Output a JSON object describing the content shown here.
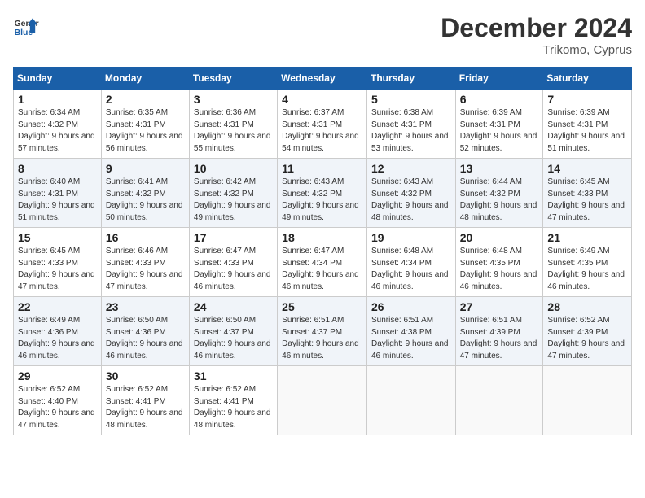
{
  "header": {
    "logo_line1": "General",
    "logo_line2": "Blue",
    "month_year": "December 2024",
    "location": "Trikomo, Cyprus"
  },
  "days_of_week": [
    "Sunday",
    "Monday",
    "Tuesday",
    "Wednesday",
    "Thursday",
    "Friday",
    "Saturday"
  ],
  "weeks": [
    [
      {
        "day": "1",
        "sunrise": "6:34 AM",
        "sunset": "4:32 PM",
        "daylight": "9 hours and 57 minutes."
      },
      {
        "day": "2",
        "sunrise": "6:35 AM",
        "sunset": "4:31 PM",
        "daylight": "9 hours and 56 minutes."
      },
      {
        "day": "3",
        "sunrise": "6:36 AM",
        "sunset": "4:31 PM",
        "daylight": "9 hours and 55 minutes."
      },
      {
        "day": "4",
        "sunrise": "6:37 AM",
        "sunset": "4:31 PM",
        "daylight": "9 hours and 54 minutes."
      },
      {
        "day": "5",
        "sunrise": "6:38 AM",
        "sunset": "4:31 PM",
        "daylight": "9 hours and 53 minutes."
      },
      {
        "day": "6",
        "sunrise": "6:39 AM",
        "sunset": "4:31 PM",
        "daylight": "9 hours and 52 minutes."
      },
      {
        "day": "7",
        "sunrise": "6:39 AM",
        "sunset": "4:31 PM",
        "daylight": "9 hours and 51 minutes."
      }
    ],
    [
      {
        "day": "8",
        "sunrise": "6:40 AM",
        "sunset": "4:31 PM",
        "daylight": "9 hours and 51 minutes."
      },
      {
        "day": "9",
        "sunrise": "6:41 AM",
        "sunset": "4:32 PM",
        "daylight": "9 hours and 50 minutes."
      },
      {
        "day": "10",
        "sunrise": "6:42 AM",
        "sunset": "4:32 PM",
        "daylight": "9 hours and 49 minutes."
      },
      {
        "day": "11",
        "sunrise": "6:43 AM",
        "sunset": "4:32 PM",
        "daylight": "9 hours and 49 minutes."
      },
      {
        "day": "12",
        "sunrise": "6:43 AM",
        "sunset": "4:32 PM",
        "daylight": "9 hours and 48 minutes."
      },
      {
        "day": "13",
        "sunrise": "6:44 AM",
        "sunset": "4:32 PM",
        "daylight": "9 hours and 48 minutes."
      },
      {
        "day": "14",
        "sunrise": "6:45 AM",
        "sunset": "4:33 PM",
        "daylight": "9 hours and 47 minutes."
      }
    ],
    [
      {
        "day": "15",
        "sunrise": "6:45 AM",
        "sunset": "4:33 PM",
        "daylight": "9 hours and 47 minutes."
      },
      {
        "day": "16",
        "sunrise": "6:46 AM",
        "sunset": "4:33 PM",
        "daylight": "9 hours and 47 minutes."
      },
      {
        "day": "17",
        "sunrise": "6:47 AM",
        "sunset": "4:33 PM",
        "daylight": "9 hours and 46 minutes."
      },
      {
        "day": "18",
        "sunrise": "6:47 AM",
        "sunset": "4:34 PM",
        "daylight": "9 hours and 46 minutes."
      },
      {
        "day": "19",
        "sunrise": "6:48 AM",
        "sunset": "4:34 PM",
        "daylight": "9 hours and 46 minutes."
      },
      {
        "day": "20",
        "sunrise": "6:48 AM",
        "sunset": "4:35 PM",
        "daylight": "9 hours and 46 minutes."
      },
      {
        "day": "21",
        "sunrise": "6:49 AM",
        "sunset": "4:35 PM",
        "daylight": "9 hours and 46 minutes."
      }
    ],
    [
      {
        "day": "22",
        "sunrise": "6:49 AM",
        "sunset": "4:36 PM",
        "daylight": "9 hours and 46 minutes."
      },
      {
        "day": "23",
        "sunrise": "6:50 AM",
        "sunset": "4:36 PM",
        "daylight": "9 hours and 46 minutes."
      },
      {
        "day": "24",
        "sunrise": "6:50 AM",
        "sunset": "4:37 PM",
        "daylight": "9 hours and 46 minutes."
      },
      {
        "day": "25",
        "sunrise": "6:51 AM",
        "sunset": "4:37 PM",
        "daylight": "9 hours and 46 minutes."
      },
      {
        "day": "26",
        "sunrise": "6:51 AM",
        "sunset": "4:38 PM",
        "daylight": "9 hours and 46 minutes."
      },
      {
        "day": "27",
        "sunrise": "6:51 AM",
        "sunset": "4:39 PM",
        "daylight": "9 hours and 47 minutes."
      },
      {
        "day": "28",
        "sunrise": "6:52 AM",
        "sunset": "4:39 PM",
        "daylight": "9 hours and 47 minutes."
      }
    ],
    [
      {
        "day": "29",
        "sunrise": "6:52 AM",
        "sunset": "4:40 PM",
        "daylight": "9 hours and 47 minutes."
      },
      {
        "day": "30",
        "sunrise": "6:52 AM",
        "sunset": "4:41 PM",
        "daylight": "9 hours and 48 minutes."
      },
      {
        "day": "31",
        "sunrise": "6:52 AM",
        "sunset": "4:41 PM",
        "daylight": "9 hours and 48 minutes."
      },
      null,
      null,
      null,
      null
    ]
  ]
}
